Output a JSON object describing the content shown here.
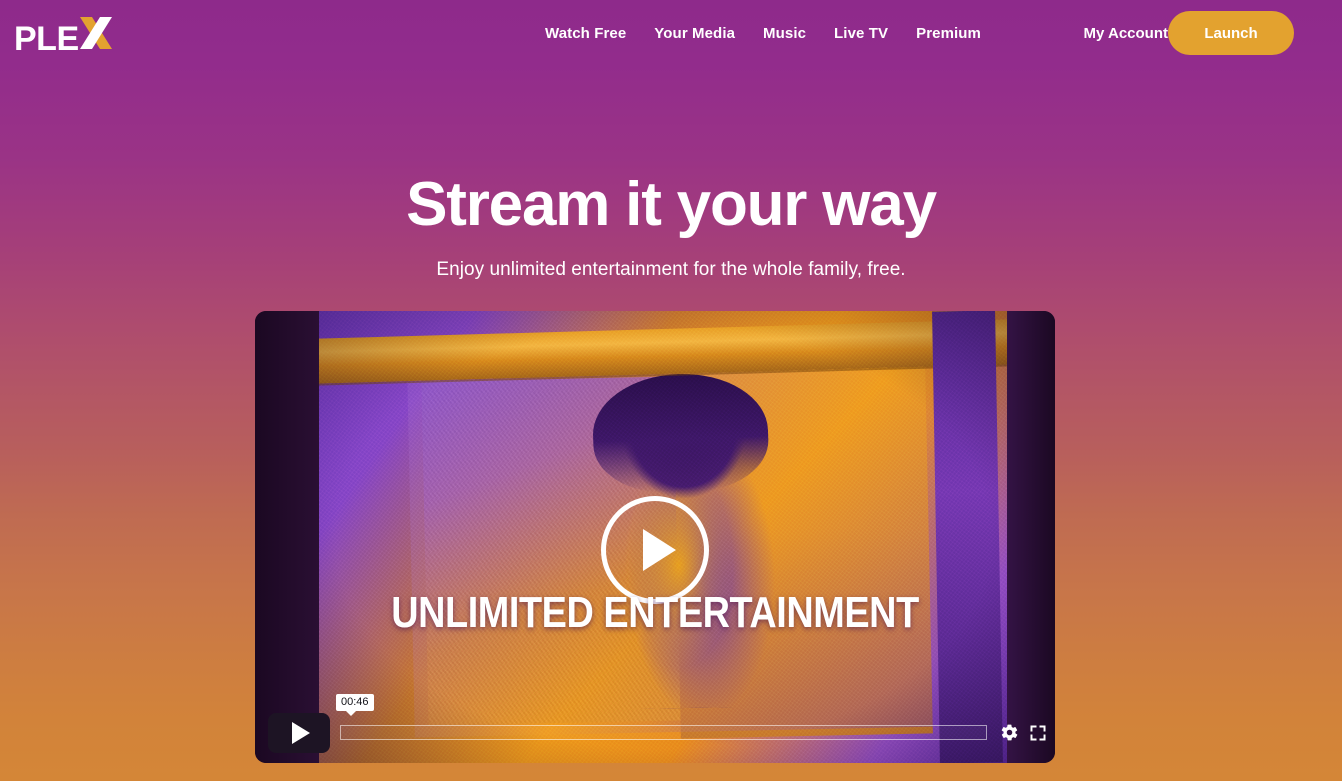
{
  "brand": {
    "logo_text": "PLE",
    "logo_accent_letter": "X",
    "accent_color": "#E3A22F",
    "logo_color": "#FFFFFF"
  },
  "header": {
    "nav": [
      {
        "label": "Watch Free"
      },
      {
        "label": "Your Media"
      },
      {
        "label": "Music"
      },
      {
        "label": "Live TV"
      },
      {
        "label": "Premium"
      }
    ],
    "account_label": "My Account",
    "launch_label": "Launch"
  },
  "hero": {
    "title": "Stream it your way",
    "subtitle": "Enjoy unlimited entertainment for the whole family, free."
  },
  "player": {
    "caption": "UNLIMITED ENTERTAINMENT",
    "current_time": "00:46",
    "play_overlay_icon": "play-icon",
    "controls": {
      "play_icon": "play-icon",
      "settings_icon": "gear-icon",
      "fullscreen_icon": "fullscreen-icon"
    }
  },
  "theme": {
    "bg_top": "#8E2A8B",
    "bg_bottom": "#D48637",
    "player_bg": "#1D0A26"
  }
}
